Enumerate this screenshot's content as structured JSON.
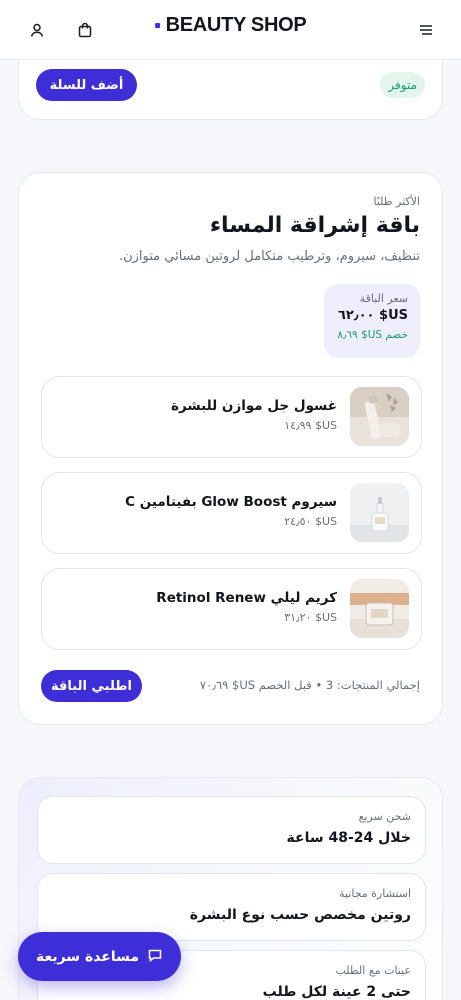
{
  "header": {
    "brand": "BEAUTY SHOP",
    "icons": [
      "menu-icon",
      "user-icon",
      "cart-icon"
    ]
  },
  "previous_product": {
    "add_to_cart_label": "أضف للسلة",
    "stock_label": "متوفر"
  },
  "bundle": {
    "eyebrow": "الأكثر طلبًا",
    "title": "باقة إشراقة المساء",
    "description": "تنظيف، سيروم، وترطيب متكامل لروتين مسائي متوازن.",
    "price_label": "سعر الباقة",
    "price": "US$ ٦٢٫٠٠",
    "savings": "خصم US$ ٨٫٦٩",
    "items": [
      {
        "name": "غسول جل موازن للبشرة",
        "price": "US$ ١٤٫٩٩"
      },
      {
        "name": "سيروم Glow Boost بفيتامين C",
        "price": "US$ ٢٤٫٥٠"
      },
      {
        "name": "كريم ليلي Retinol Renew",
        "price": "US$ ٣١٫٢٠"
      }
    ],
    "summary": "إجمالي المنتجات: 3 • قبل الخصم US$ ٧٠٫٦٩",
    "order_button": "اطلبي الباقة"
  },
  "features": [
    {
      "label": "شحن سريع",
      "value": "خلال 24-48 ساعة"
    },
    {
      "label": "استشارة مجانية",
      "value": "روتين مخصص حسب نوع البشرة"
    },
    {
      "label": "عينات مع الطلب",
      "value": "حتى 2 عينة لكل طلب"
    }
  ],
  "help_button": "مساعدة سريعة",
  "colors": {
    "accent": "#3d2ed8",
    "success": "#1b9a6b"
  }
}
